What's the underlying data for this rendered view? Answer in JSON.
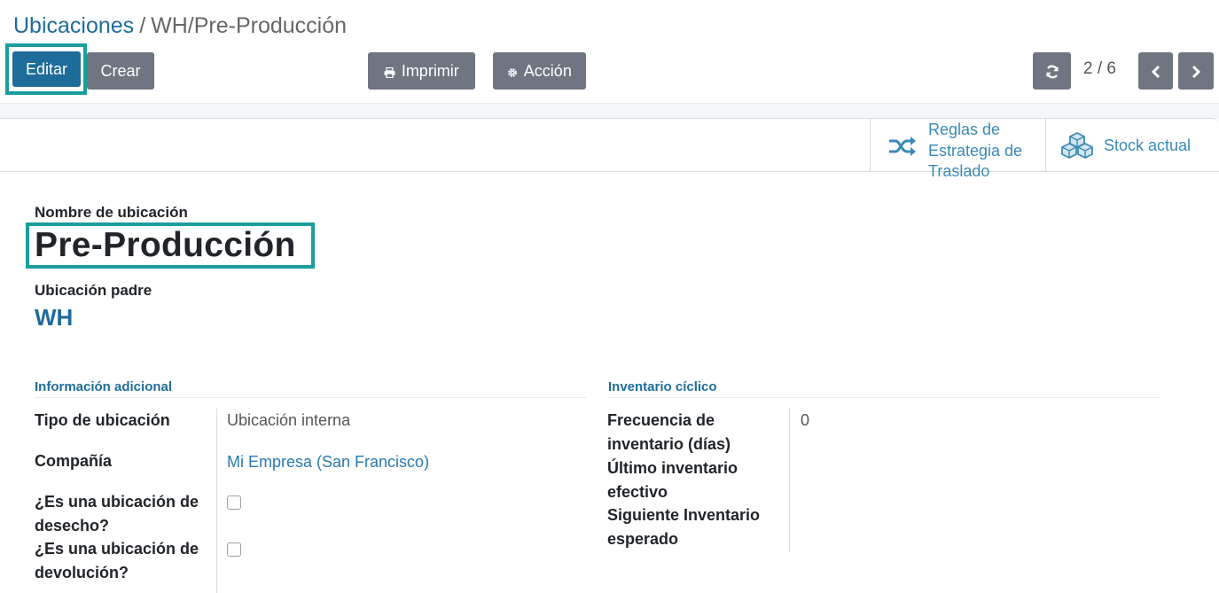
{
  "breadcrumb": {
    "parent": "Ubicaciones",
    "separator": "/",
    "current": "WH/Pre-Producción"
  },
  "toolbar": {
    "edit_label": "Editar",
    "create_label": "Crear",
    "print_label": "Imprimir",
    "action_label": "Acción"
  },
  "pager": {
    "value": "2 / 6"
  },
  "smart_buttons": {
    "rules_label": "Reglas de Estrategia de Traslado",
    "stock_label": "Stock actual"
  },
  "form": {
    "name_label": "Nombre de ubicación",
    "name_value": "Pre-Producción",
    "parent_label": "Ubicación padre",
    "parent_value": "WH"
  },
  "group_info": {
    "title": "Información adicional",
    "type_label": "Tipo de ubicación",
    "type_value": "Ubicación interna",
    "company_label": "Compañía",
    "company_value": "Mi Empresa (San Francisco)",
    "scrap_label": "¿Es una ubicación de desecho?",
    "scrap_checked": false,
    "return_label": "¿Es una ubicación de devolución?",
    "return_checked": false
  },
  "group_cycle": {
    "title": "Inventario cíclico",
    "freq_label": "Frecuencia de inventario (días)",
    "freq_value": "0",
    "last_label": "Último inventario efectivo",
    "next_label": "Siguiente Inventario esperado"
  },
  "colors": {
    "primary": "#1d6c9a",
    "secondary": "#6f7581",
    "link": "#1f6d99",
    "highlight": "#1a9e9c"
  }
}
